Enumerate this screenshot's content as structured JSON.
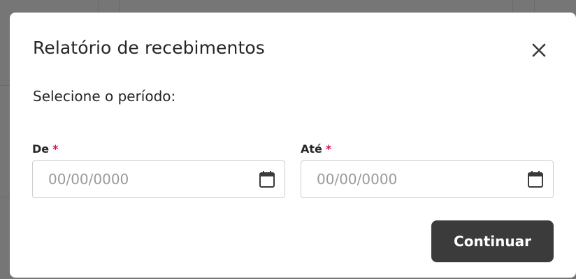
{
  "modal": {
    "title": "Relatório de recebimentos",
    "subtitle": "Selecione o período:",
    "fields": [
      {
        "label": "De",
        "required_mark": "*",
        "placeholder": "00/00/0000",
        "value": ""
      },
      {
        "label": "Até",
        "required_mark": "*",
        "placeholder": "00/00/0000",
        "value": ""
      }
    ],
    "continue_label": "Continuar"
  },
  "colors": {
    "overlay": "#767676",
    "modal_bg": "#ffffff",
    "text": "#262626",
    "required": "#d0124b",
    "button_bg": "#3b3b3b",
    "input_border": "#cfcfcf"
  },
  "icons": [
    "close-icon",
    "calendar-icon"
  ]
}
